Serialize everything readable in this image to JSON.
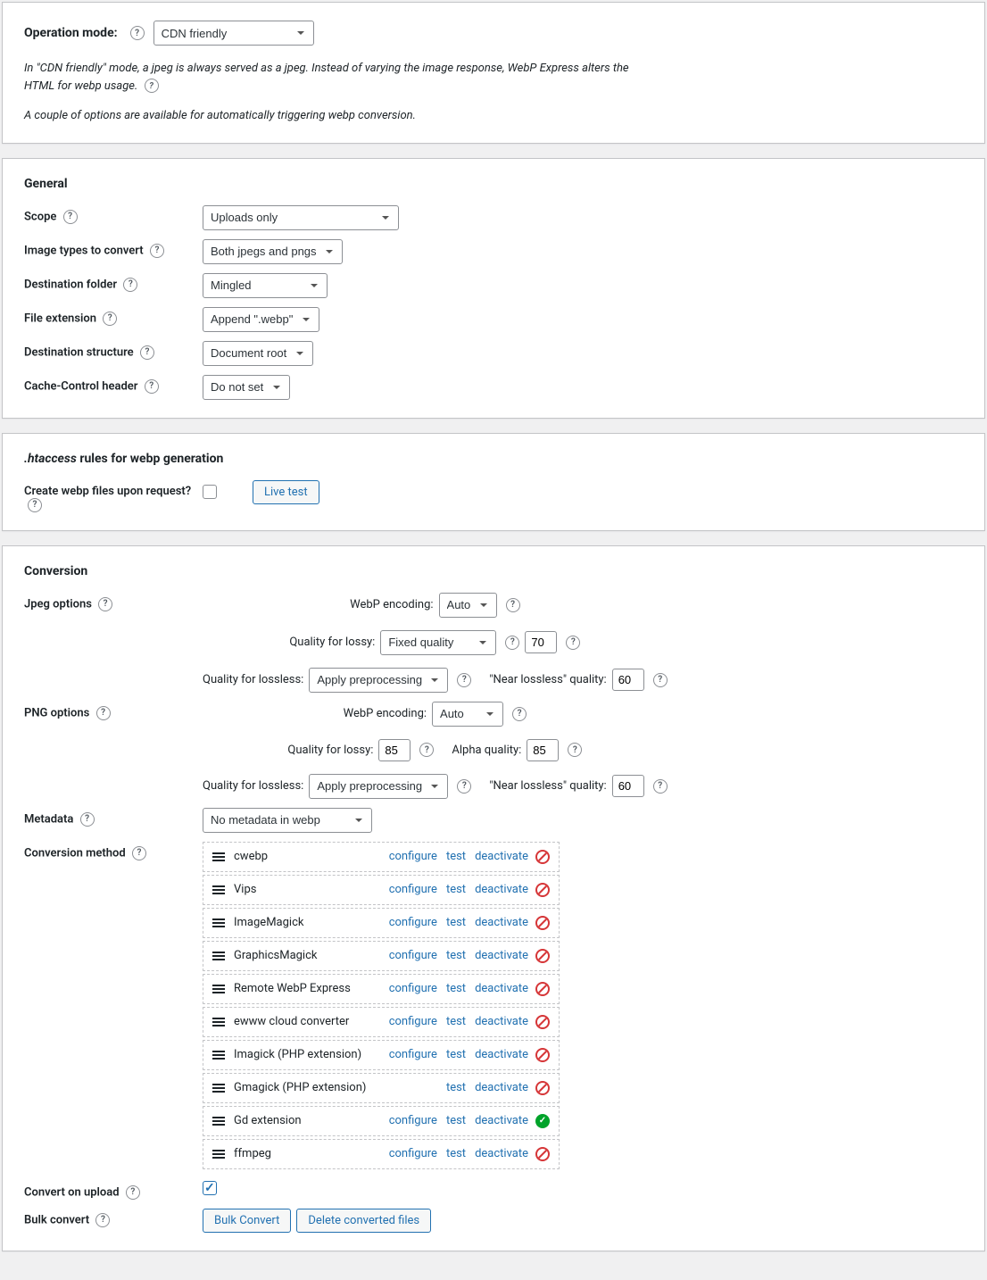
{
  "operation": {
    "label": "Operation mode:",
    "value": "CDN friendly",
    "desc1": "In \"CDN friendly\" mode, a jpeg is always served as a jpeg. Instead of varying the image response, WebP Express alters the HTML for webp usage.",
    "desc2": "A couple of options are available for automatically triggering webp conversion."
  },
  "general": {
    "title": "General",
    "scope": {
      "label": "Scope",
      "value": "Uploads only"
    },
    "image_types": {
      "label": "Image types to convert",
      "value": "Both jpegs and pngs"
    },
    "dest_folder": {
      "label": "Destination folder",
      "value": "Mingled"
    },
    "file_ext": {
      "label": "File extension",
      "value": "Append \".webp\""
    },
    "dest_struct": {
      "label": "Destination structure",
      "value": "Document root"
    },
    "cache_control": {
      "label": "Cache-Control header",
      "value": "Do not set"
    }
  },
  "htaccess": {
    "title_prefix": ".htaccess",
    "title_suffix": " rules for webp generation",
    "create_label": "Create webp files upon request?",
    "live_test": "Live test"
  },
  "conversion": {
    "title": "Conversion",
    "jpeg": {
      "label": "Jpeg options",
      "encoding_label": "WebP encoding:",
      "encoding_value": "Auto",
      "lossy_label": "Quality for lossy:",
      "lossy_mode": "Fixed quality",
      "lossy_value": "70",
      "lossless_label": "Quality for lossless:",
      "lossless_mode": "Apply preprocessing",
      "near_label": "\"Near lossless\" quality:",
      "near_value": "60"
    },
    "png": {
      "label": "PNG options",
      "encoding_label": "WebP encoding:",
      "encoding_value": "Auto",
      "lossy_label": "Quality for lossy:",
      "lossy_value": "85",
      "alpha_label": "Alpha quality:",
      "alpha_value": "85",
      "lossless_label": "Quality for lossless:",
      "lossless_mode": "Apply preprocessing",
      "near_label": "\"Near lossless\" quality:",
      "near_value": "60"
    },
    "metadata": {
      "label": "Metadata",
      "value": "No metadata in webp"
    },
    "method": {
      "label": "Conversion method",
      "items": [
        {
          "name": "cwebp",
          "configure": true,
          "status": "fail"
        },
        {
          "name": "Vips",
          "configure": true,
          "status": "fail"
        },
        {
          "name": "ImageMagick",
          "configure": true,
          "status": "fail"
        },
        {
          "name": "GraphicsMagick",
          "configure": true,
          "status": "fail"
        },
        {
          "name": "Remote WebP Express",
          "configure": true,
          "status": "fail"
        },
        {
          "name": "ewww cloud converter",
          "configure": true,
          "status": "fail"
        },
        {
          "name": "Imagick (PHP extension)",
          "configure": true,
          "status": "fail"
        },
        {
          "name": "Gmagick (PHP extension)",
          "configure": false,
          "status": "fail"
        },
        {
          "name": "Gd extension",
          "configure": true,
          "status": "ok"
        },
        {
          "name": "ffmpeg",
          "configure": true,
          "status": "fail"
        }
      ],
      "action_configure": "configure",
      "action_test": "test",
      "action_deactivate": "deactivate"
    },
    "convert_upload": {
      "label": "Convert on upload"
    },
    "bulk": {
      "label": "Bulk convert",
      "btn_convert": "Bulk Convert",
      "btn_delete": "Delete converted files"
    }
  }
}
